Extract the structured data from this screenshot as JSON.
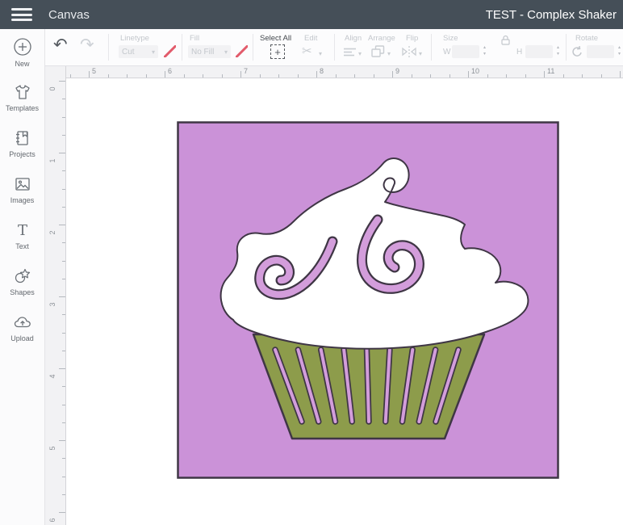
{
  "topbar": {
    "title": "Canvas",
    "project_title": "TEST - Complex Shaker"
  },
  "icons": {
    "undo": "↶",
    "redo": "↷",
    "caret": "▾",
    "scissors": "✂",
    "plus": "+",
    "stepper": "▴\n▾"
  },
  "toolbar": {
    "linetype": {
      "label": "Linetype",
      "value": "Cut"
    },
    "fill": {
      "label": "Fill",
      "value": "No Fill"
    },
    "select_all": {
      "label": "Select All"
    },
    "edit": {
      "label": "Edit"
    },
    "align": {
      "label": "Align"
    },
    "arrange": {
      "label": "Arrange"
    },
    "flip": {
      "label": "Flip"
    },
    "size": {
      "label": "Size",
      "w_label": "W",
      "w_value": "",
      "h_label": "H",
      "h_value": ""
    },
    "rotate": {
      "label": "Rotate",
      "value": ""
    }
  },
  "sidebar": {
    "items": [
      {
        "label": "New"
      },
      {
        "label": "Templates"
      },
      {
        "label": "Projects"
      },
      {
        "label": "Images"
      },
      {
        "label": "Text"
      },
      {
        "label": "Shapes"
      },
      {
        "label": "Upload"
      }
    ]
  },
  "rulers": {
    "horizontal_numbers": [
      5,
      6,
      7,
      8,
      9,
      10,
      11
    ],
    "vertical_numbers": [
      0,
      1,
      2,
      3,
      4,
      5,
      6
    ]
  },
  "canvas": {
    "artwork": {
      "name": "cupcake shaker design",
      "background_color": "#cb92d8",
      "frosting_color": "#ffffff",
      "cup_color": "#8d9c4b",
      "slot_color": "#d39ddb",
      "outline_color": "#3f3645",
      "slot_count": 9
    }
  },
  "colors": {
    "topbar_bg": "#454f58",
    "accent_swatch": "#e25c6c",
    "disabled_text": "#c3c7cc",
    "enabled_text": "#43484d"
  }
}
